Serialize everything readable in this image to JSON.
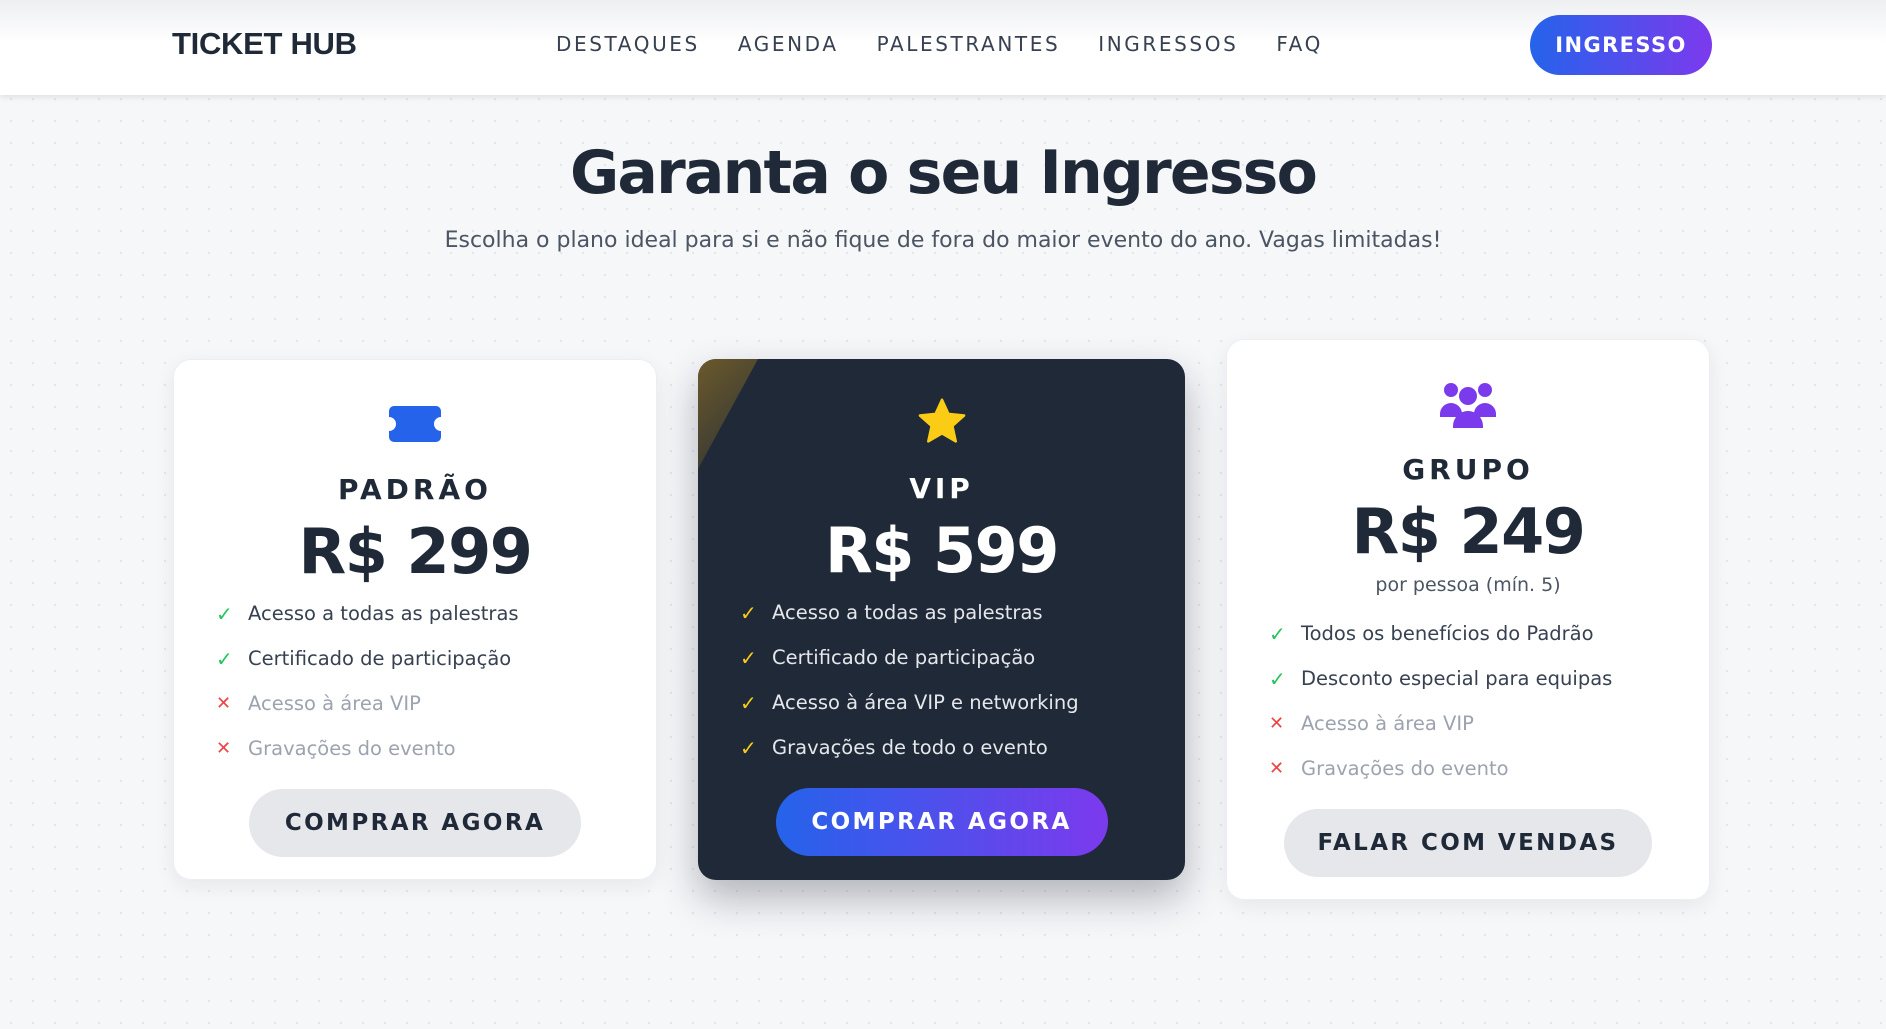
{
  "header": {
    "logo": "TICKET HUB",
    "nav": [
      "DESTAQUES",
      "AGENDA",
      "PALESTRANTES",
      "INGRESSOS",
      "FAQ"
    ],
    "cta_label": "INGRESSO"
  },
  "hero": {
    "title": "Garanta o seu Ingresso",
    "subtitle": "Escolha o plano ideal para si e não fique de fora do maior evento do ano. Vagas limitadas!"
  },
  "plans": [
    {
      "icon": "ticket-icon",
      "name": "PADRÃO",
      "price": "R$ 299",
      "features": [
        {
          "text": "Acesso a todas as palestras",
          "included": true
        },
        {
          "text": "Certificado de participação",
          "included": true
        },
        {
          "text": "Acesso à área VIP",
          "included": false
        },
        {
          "text": "Gravações do evento",
          "included": false
        }
      ],
      "button": "COMPRAR AGORA"
    },
    {
      "icon": "star-icon",
      "name": "VIP",
      "price": "R$ 599",
      "features": [
        {
          "text": "Acesso a todas as palestras",
          "included": true
        },
        {
          "text": "Certificado de participação",
          "included": true
        },
        {
          "text": "Acesso à área VIP e networking",
          "included": true
        },
        {
          "text": "Gravações de todo o evento",
          "included": true
        }
      ],
      "button": "COMPRAR AGORA"
    },
    {
      "icon": "users-group-icon",
      "name": "GRUPO",
      "price": "R$ 249",
      "note": "por pessoa (mín. 5)",
      "features": [
        {
          "text": "Todos os benefícios do Padrão",
          "included": true
        },
        {
          "text": "Desconto especial para equipas",
          "included": true
        },
        {
          "text": "Acesso à área VIP",
          "included": false
        },
        {
          "text": "Gravações do evento",
          "included": false
        }
      ],
      "button": "FALAR COM VENDAS"
    }
  ],
  "colors": {
    "accent_start": "#2563eb",
    "accent_end": "#7c3aed",
    "dark_card": "#1f2937",
    "check_green": "#22c55e",
    "cross_red": "#ef4444",
    "star_yellow": "#facc15",
    "group_purple": "#7c3aed",
    "ticket_blue": "#2563eb"
  }
}
